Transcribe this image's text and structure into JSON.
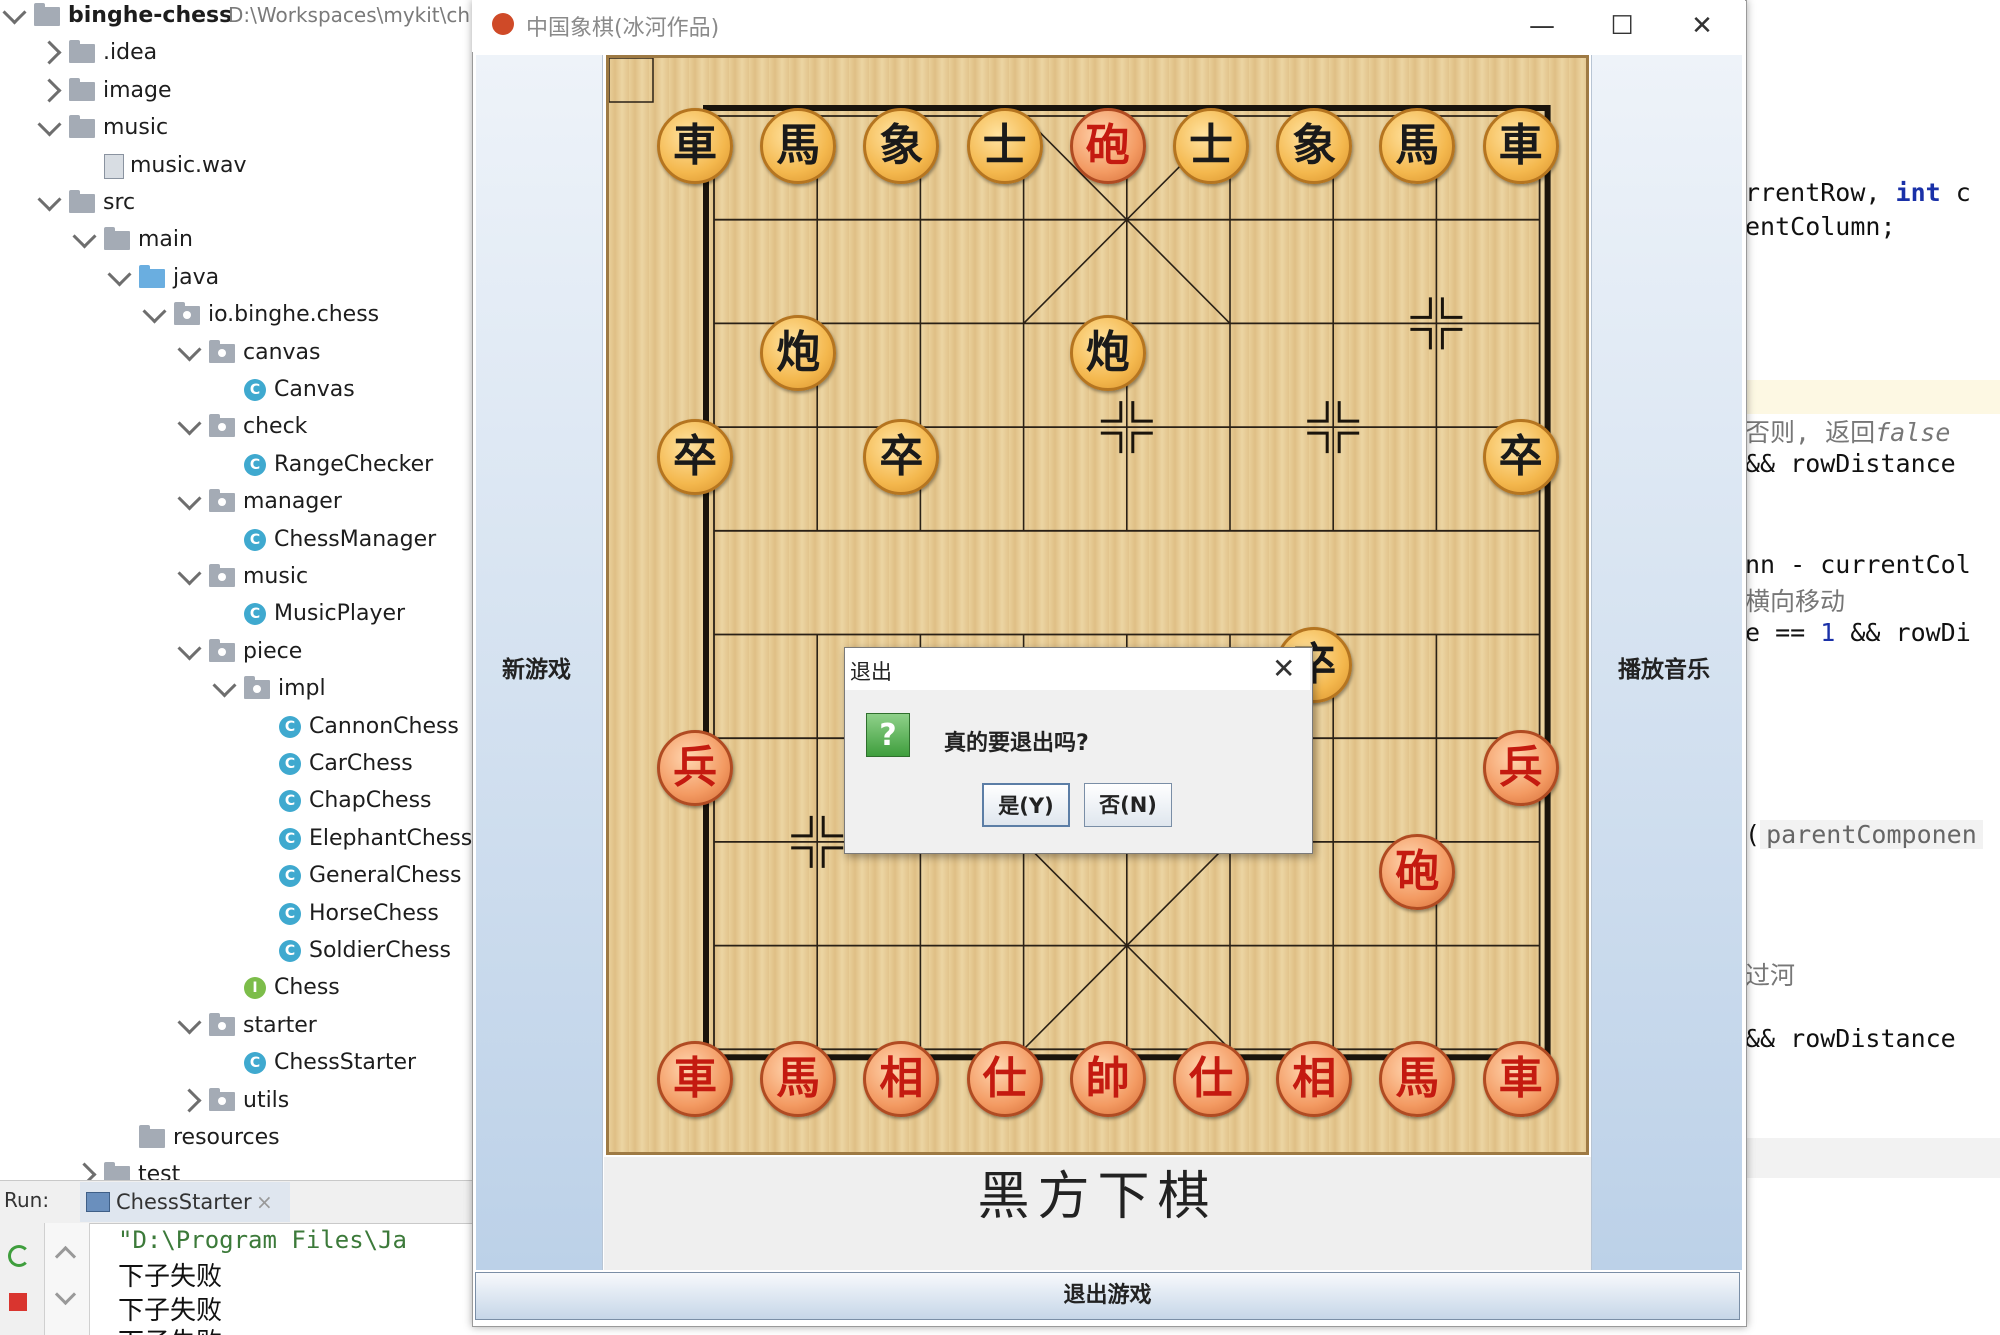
{
  "project_tree": {
    "items": [
      {
        "label": "binghe-chess",
        "path": "D:\\Workspaces\\mykit\\ch",
        "level": 0,
        "type": "project",
        "expanded": true
      },
      {
        "label": ".idea",
        "level": 1,
        "type": "folder",
        "expanded": false
      },
      {
        "label": "image",
        "level": 1,
        "type": "folder",
        "expanded": false
      },
      {
        "label": "music",
        "level": 1,
        "type": "folder",
        "expanded": true
      },
      {
        "label": "music.wav",
        "level": 2,
        "type": "file"
      },
      {
        "label": "src",
        "level": 1,
        "type": "folder",
        "expanded": true
      },
      {
        "label": "main",
        "level": 2,
        "type": "folder",
        "expanded": true
      },
      {
        "label": "java",
        "level": 3,
        "type": "source-folder",
        "expanded": true
      },
      {
        "label": "io.binghe.chess",
        "level": 4,
        "type": "package",
        "expanded": true
      },
      {
        "label": "canvas",
        "level": 5,
        "type": "package",
        "expanded": true
      },
      {
        "label": "Canvas",
        "level": 6,
        "type": "class"
      },
      {
        "label": "check",
        "level": 5,
        "type": "package",
        "expanded": true
      },
      {
        "label": "RangeChecker",
        "level": 6,
        "type": "class"
      },
      {
        "label": "manager",
        "level": 5,
        "type": "package",
        "expanded": true
      },
      {
        "label": "ChessManager",
        "level": 6,
        "type": "class"
      },
      {
        "label": "music",
        "level": 5,
        "type": "package",
        "expanded": true
      },
      {
        "label": "MusicPlayer",
        "level": 6,
        "type": "class"
      },
      {
        "label": "piece",
        "level": 5,
        "type": "package",
        "expanded": true
      },
      {
        "label": "impl",
        "level": 6,
        "type": "package",
        "expanded": true
      },
      {
        "label": "CannonChess",
        "level": 7,
        "type": "class"
      },
      {
        "label": "CarChess",
        "level": 7,
        "type": "class"
      },
      {
        "label": "ChapChess",
        "level": 7,
        "type": "class"
      },
      {
        "label": "ElephantChess",
        "level": 7,
        "type": "class"
      },
      {
        "label": "GeneralChess",
        "level": 7,
        "type": "class"
      },
      {
        "label": "HorseChess",
        "level": 7,
        "type": "class"
      },
      {
        "label": "SoldierChess",
        "level": 7,
        "type": "class"
      },
      {
        "label": "Chess",
        "level": 6,
        "type": "interface"
      },
      {
        "label": "starter",
        "level": 5,
        "type": "package",
        "expanded": true
      },
      {
        "label": "ChessStarter",
        "level": 6,
        "type": "class"
      },
      {
        "label": "utils",
        "level": 5,
        "type": "package",
        "expanded": false
      },
      {
        "label": "resources",
        "level": 3,
        "type": "folder"
      },
      {
        "label": "test",
        "level": 2,
        "type": "folder",
        "expanded": false
      }
    ]
  },
  "run_panel": {
    "label": "Run:",
    "tab_label": "ChessStarter",
    "close_glyph": "×",
    "lines": [
      "\"D:\\Program Files\\Ja",
      "下子失败",
      "下子失败",
      "下子失败"
    ]
  },
  "code_editor": {
    "lines": [
      {
        "text": "rrentRow, ",
        "kw": "int",
        "tail": " c"
      },
      {
        "text": "entColumn;"
      },
      {
        "text": "否则, 返回",
        "italic": "false"
      },
      {
        "text": "&& rowDistance"
      },
      {
        "text": "nn - currentCol"
      },
      {
        "text": "横向移动"
      },
      {
        "text": "e == ",
        "num": "1",
        "tail": " && rowDi"
      },
      {
        "text": "(",
        "hint": "parentComponen"
      },
      {
        "text": "过河"
      },
      {
        "text": "&& rowDistance"
      }
    ]
  },
  "chess_window": {
    "title": "中国象棋(冰河作品)",
    "minimize_glyph": "—",
    "maximize_glyph": "☐",
    "close_glyph": "✕",
    "new_game_label": "新游戏",
    "play_music_label": "播放音乐",
    "turn_status": "黑方下棋",
    "exit_game_label": "退出游戏",
    "colors": {
      "board": "#e6c994",
      "red_piece": "#c41a10",
      "black_piece": "#1a1a1a"
    }
  },
  "board": {
    "pieces": [
      {
        "char": "車",
        "side": "black",
        "col": 0,
        "row": 0
      },
      {
        "char": "馬",
        "side": "black",
        "col": 1,
        "row": 0
      },
      {
        "char": "象",
        "side": "black",
        "col": 2,
        "row": 0
      },
      {
        "char": "士",
        "side": "black",
        "col": 3,
        "row": 0
      },
      {
        "char": "砲",
        "side": "red",
        "col": 4,
        "row": 0
      },
      {
        "char": "士",
        "side": "black",
        "col": 5,
        "row": 0
      },
      {
        "char": "象",
        "side": "black",
        "col": 6,
        "row": 0
      },
      {
        "char": "馬",
        "side": "black",
        "col": 7,
        "row": 0
      },
      {
        "char": "車",
        "side": "black",
        "col": 8,
        "row": 0
      },
      {
        "char": "炮",
        "side": "black",
        "col": 1,
        "row": 2
      },
      {
        "char": "炮",
        "side": "black",
        "col": 4,
        "row": 2
      },
      {
        "char": "卒",
        "side": "black",
        "col": 0,
        "row": 3
      },
      {
        "char": "卒",
        "side": "black",
        "col": 2,
        "row": 3
      },
      {
        "char": "卒",
        "side": "black",
        "col": 8,
        "row": 3
      },
      {
        "char": "卒",
        "side": "black",
        "col": 6,
        "row": 5
      },
      {
        "char": "兵",
        "side": "red",
        "col": 0,
        "row": 6
      },
      {
        "char": "兵",
        "side": "red",
        "col": 8,
        "row": 6
      },
      {
        "char": "砲",
        "side": "red",
        "col": 7,
        "row": 7
      },
      {
        "char": "車",
        "side": "red",
        "col": 0,
        "row": 9
      },
      {
        "char": "馬",
        "side": "red",
        "col": 1,
        "row": 9
      },
      {
        "char": "相",
        "side": "red",
        "col": 2,
        "row": 9
      },
      {
        "char": "仕",
        "side": "red",
        "col": 3,
        "row": 9
      },
      {
        "char": "帥",
        "side": "red",
        "col": 4,
        "row": 9
      },
      {
        "char": "仕",
        "side": "red",
        "col": 5,
        "row": 9
      },
      {
        "char": "相",
        "side": "red",
        "col": 6,
        "row": 9
      },
      {
        "char": "馬",
        "side": "red",
        "col": 7,
        "row": 9
      },
      {
        "char": "車",
        "side": "red",
        "col": 8,
        "row": 9
      }
    ],
    "markers": [
      {
        "col": 7,
        "row": 2
      },
      {
        "col": 4,
        "row": 3
      },
      {
        "col": 6,
        "row": 3
      },
      {
        "col": 1,
        "row": 7
      }
    ]
  },
  "dialog": {
    "title": "退出",
    "close_glyph": "✕",
    "icon": "question-icon",
    "icon_glyph": "?",
    "message": "真的要退出吗?",
    "yes_label": "是(Y)",
    "no_label": "否(N)"
  }
}
